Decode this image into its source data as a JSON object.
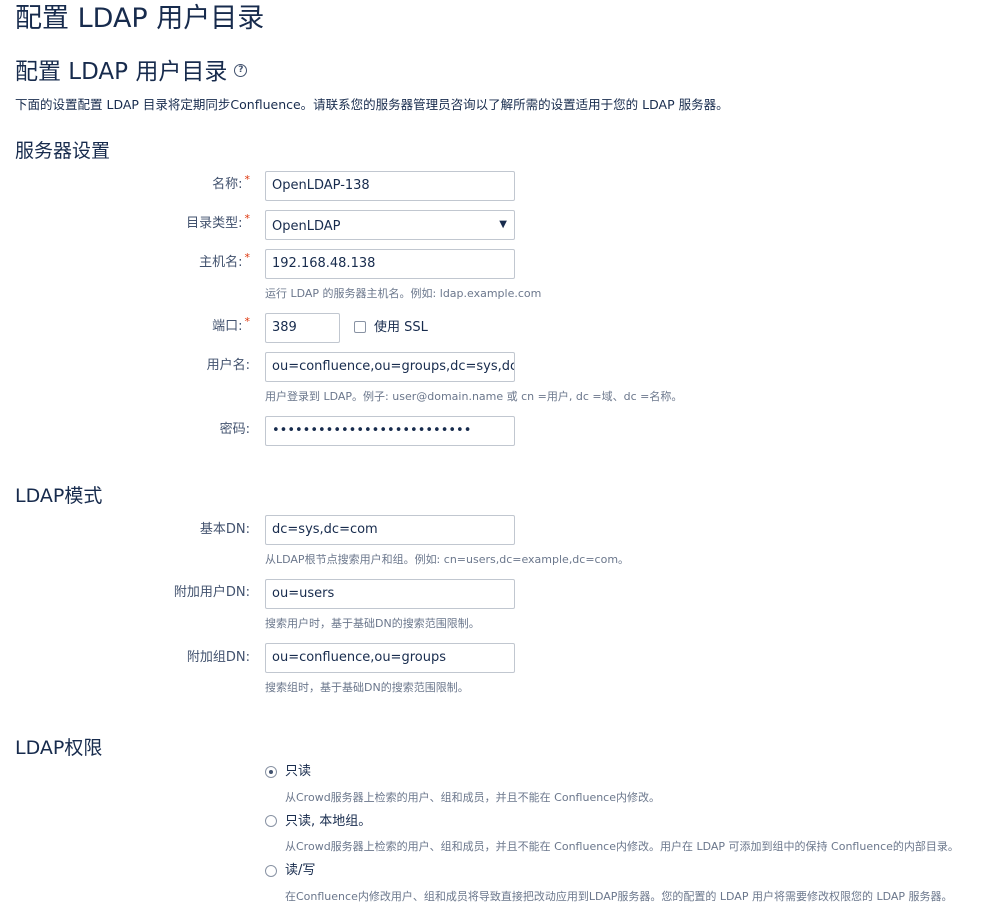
{
  "page": {
    "title": "配置 LDAP 用户目录",
    "heading": "配置 LDAP 用户目录",
    "help_icon": "question-circle-icon",
    "intro": "下面的设置配置 LDAP 目录将定期同步Confluence。请联系您的服务器管理员咨询以了解所需的设置适用于您的 LDAP 服务器。"
  },
  "server_settings": {
    "title": "服务器设置",
    "required_marker": "*",
    "name": {
      "label": "名称:",
      "value": "OpenLDAP-138"
    },
    "directory_type": {
      "label": "目录类型:",
      "value": "OpenLDAP",
      "arrow": "▼"
    },
    "hostname": {
      "label": "主机名:",
      "value": "192.168.48.138",
      "hint": "运行 LDAP 的服务器主机名。例如: ldap.example.com"
    },
    "port": {
      "label": "端口:",
      "value": "389",
      "ssl_label": "使用 SSL",
      "ssl_checked": false
    },
    "username": {
      "label": "用户名:",
      "value": "ou=confluence,ou=groups,dc=sys,dc=",
      "hint": "用户登录到 LDAP。例子: user@domain.name 或 cn =用户, dc =域、dc =名称。"
    },
    "password": {
      "label": "密码:",
      "value": "••••••••••••••••••••••••••"
    }
  },
  "ldap_schema": {
    "title": "LDAP模式",
    "base_dn": {
      "label": "基本DN:",
      "value": "dc=sys,dc=com",
      "hint": "从LDAP根节点搜索用户和组。例如: cn=users,dc=example,dc=com。"
    },
    "additional_user_dn": {
      "label": "附加用户DN:",
      "value": "ou=users",
      "hint": "搜索用户时，基于基础DN的搜索范围限制。"
    },
    "additional_group_dn": {
      "label": "附加组DN:",
      "value": "ou=confluence,ou=groups",
      "hint": "搜索组时，基于基础DN的搜索范围限制。"
    }
  },
  "ldap_permissions": {
    "title": "LDAP权限",
    "options": [
      {
        "label": "只读",
        "desc": "从Crowd服务器上检索的用户、组和成员，并且不能在 Confluence内修改。",
        "checked": true
      },
      {
        "label": "只读, 本地组。",
        "desc": "从Crowd服务器上检索的用户、组和成员，并且不能在 Confluence内修改。用户在 LDAP 可添加到组中的保持 Confluence的内部目录。",
        "checked": false
      },
      {
        "label": "读/写",
        "desc": "在Confluence内修改用户、组和成员将导致直接把改动应用到LDAP服务器。您的配置的 LDAP 用户将需要修改权限您的 LDAP 服务器。",
        "checked": false
      }
    ]
  }
}
